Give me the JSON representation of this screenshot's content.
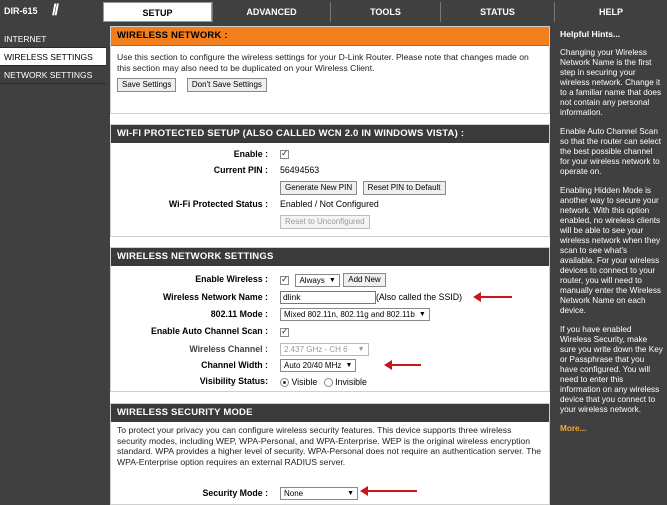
{
  "top": {
    "model": "DIR-615",
    "tabs": [
      "SETUP",
      "ADVANCED",
      "TOOLS",
      "STATUS",
      "HELP"
    ]
  },
  "sidebar": {
    "items": [
      "INTERNET",
      "WIRELESS SETTINGS",
      "NETWORK SETTINGS"
    ]
  },
  "wireless_network": {
    "title": "WIRELESS NETWORK :",
    "intro": "Use this section to configure the wireless settings for your D-Link Router. Please note that changes made on this section may also need to be duplicated on your Wireless Client.",
    "save_label": "Save Settings",
    "dont_save_label": "Don't Save Settings"
  },
  "wps": {
    "title": "WI-FI PROTECTED SETUP (ALSO CALLED WCN 2.0 IN WINDOWS VISTA) :",
    "enable_label": "Enable :",
    "current_pin_label": "Current PIN :",
    "current_pin": "56494563",
    "generate_pin": "Generate New PIN",
    "reset_pin": "Reset PIN to Default",
    "status_label": "Wi-Fi Protected Status :",
    "status_value": "Enabled / Not Configured",
    "reset_unconfigured": "Reset to Unconfigured"
  },
  "wns": {
    "title": "WIRELESS NETWORK SETTINGS",
    "enable_wireless_label": "Enable Wireless :",
    "schedule": "Always",
    "add_new": "Add New",
    "name_label": "Wireless Network Name :",
    "name_value": "dlink",
    "name_note": "(Also called the SSID)",
    "mode_label": "802.11 Mode :",
    "mode_value": "Mixed 802.11n, 802.11g and 802.11b",
    "auto_channel_label": "Enable Auto Channel Scan :",
    "channel_label": "Wireless Channel :",
    "channel_value": "2.437 GHz - CH 6",
    "width_label": "Channel Width :",
    "width_value": "Auto 20/40 MHz",
    "visibility_label": "Visibility Status:",
    "visible": "Visible",
    "invisible": "Invisible"
  },
  "security": {
    "title": "WIRELESS SECURITY MODE",
    "intro": "To protect your privacy you can configure wireless security features. This device supports three wireless security modes, including WEP, WPA-Personal, and WPA-Enterprise. WEP is the original wireless encryption standard. WPA provides a higher level of security. WPA-Personal does not require an authentication server. The WPA-Enterprise option requires an external RADIUS server.",
    "mode_label": "Security Mode :",
    "mode_value": "None"
  },
  "hints": {
    "title": "Helpful Hints...",
    "p1": "Changing your Wireless Network Name is the first step in securing your wireless network. Change it to a familiar name that does not contain any personal information.",
    "p2": "Enable Auto Channel Scan so that the router can select the best possible channel for your wireless network to operate on.",
    "p3": "Enabling Hidden Mode is another way to secure your network. With this option enabled, no wireless clients will be able to see your wireless network when they scan to see what's available. For your wireless devices to connect to your router, you will need to manually enter the Wireless Network Name on each device.",
    "p4": "If you have enabled Wireless Security, make sure you write down the Key or Passphrase that you have configured. You will need to enter this information on any wireless device that you connect to your wireless network.",
    "more": "More..."
  },
  "colors": {
    "accent_orange": "#f27e1d",
    "header_dark": "#3a3a3a",
    "annotation_red": "#c8161d"
  }
}
